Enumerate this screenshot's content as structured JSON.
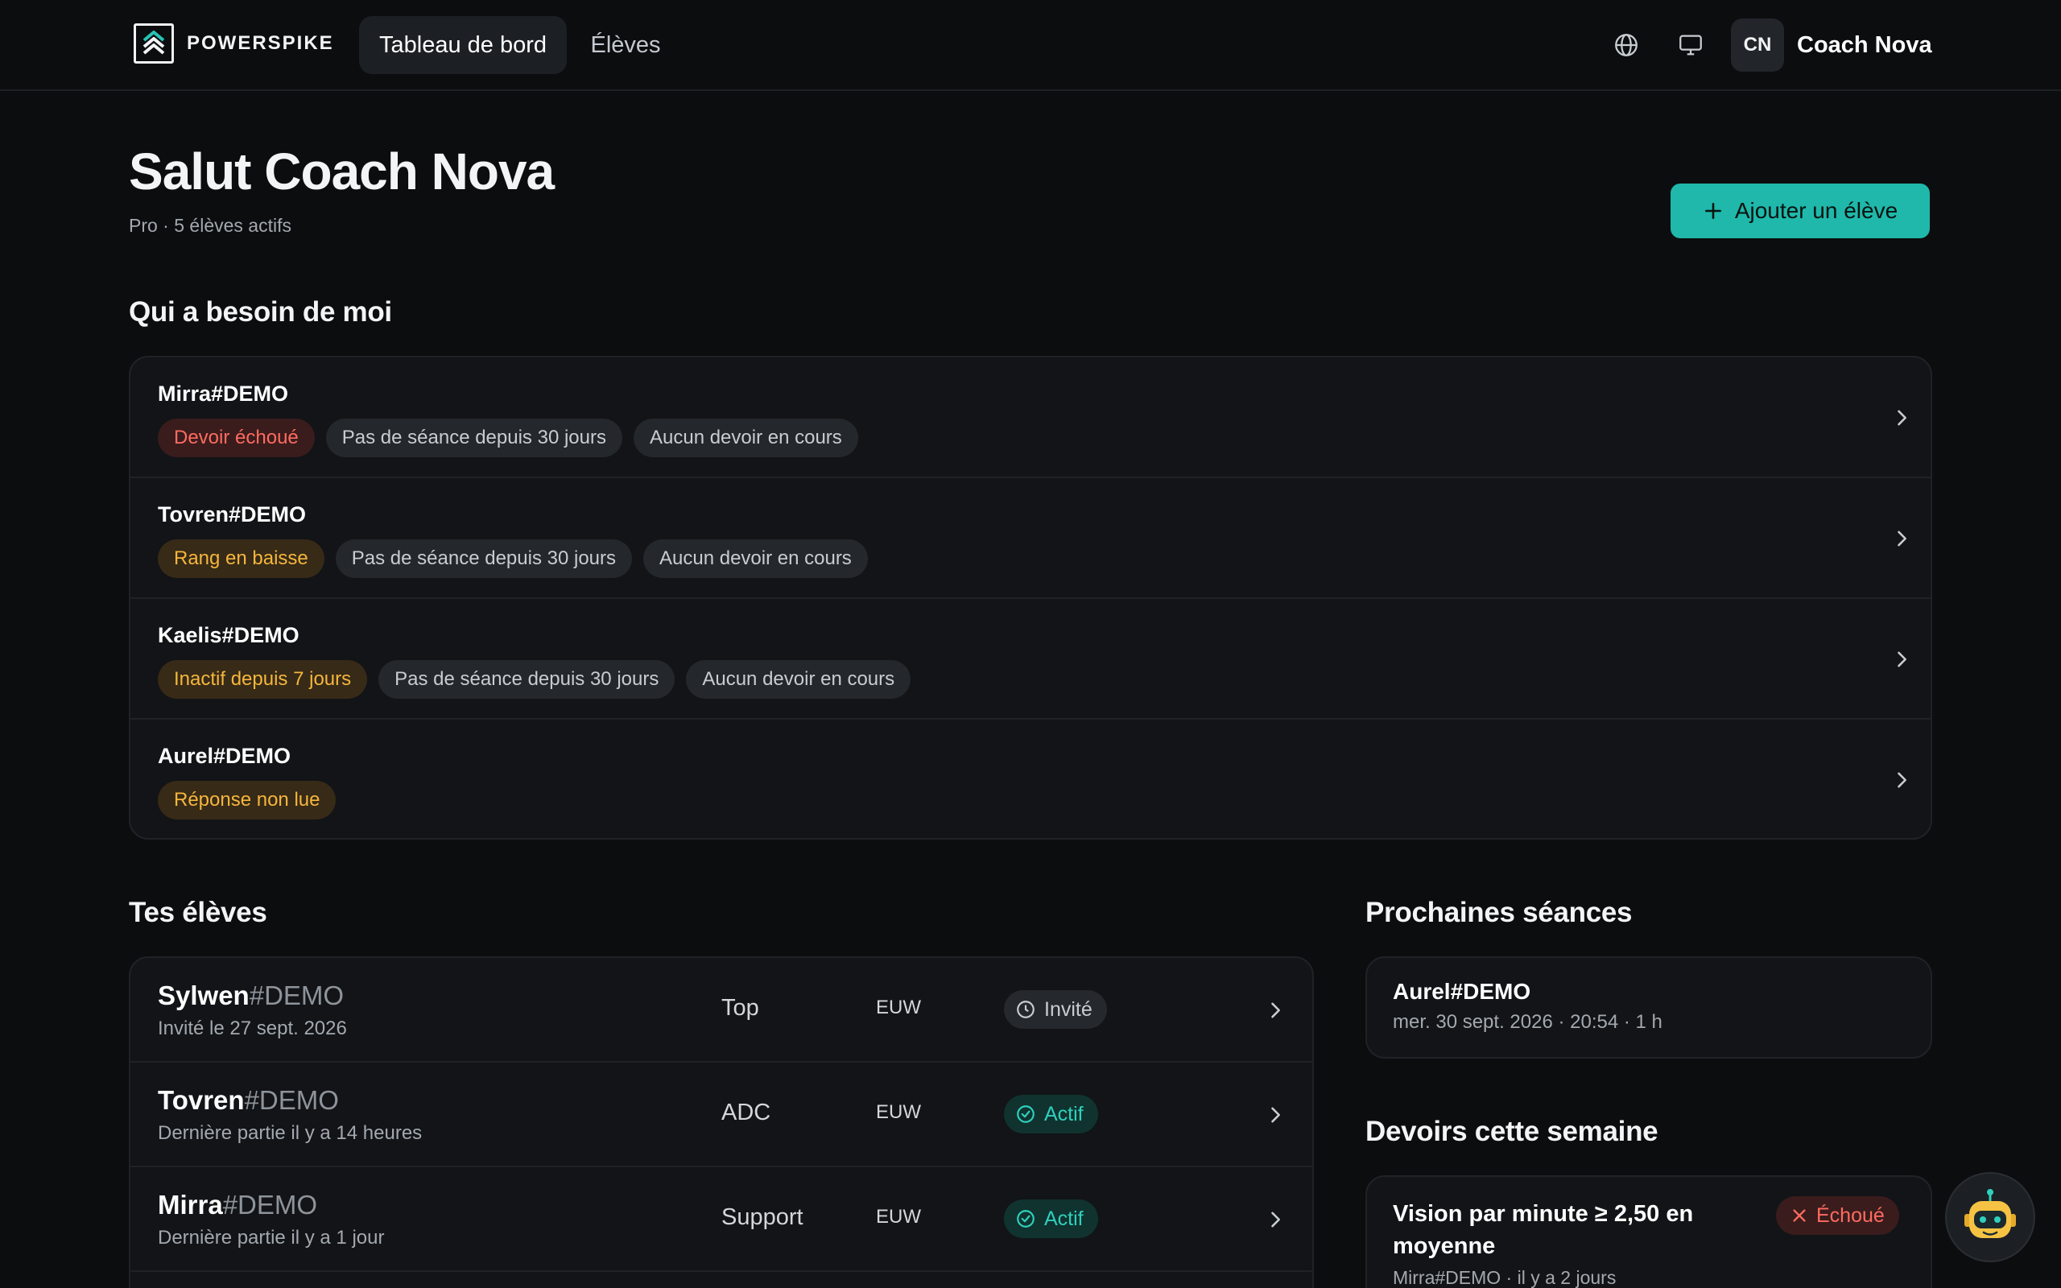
{
  "nav": {
    "brand": "POWERSPIKE",
    "tabs": [
      {
        "label": "Tableau de bord",
        "active": true
      },
      {
        "label": "Élèves",
        "active": false
      }
    ],
    "user": {
      "initials": "CN",
      "name": "Coach Nova"
    },
    "icons": [
      "globe-icon",
      "monitor-icon"
    ]
  },
  "header": {
    "title": "Salut Coach Nova",
    "subtitle": "Pro · 5 élèves actifs",
    "add_button": "Ajouter un élève"
  },
  "needs": {
    "title": "Qui a besoin de moi",
    "rows": [
      {
        "name": "Mirra#DEMO",
        "tags": [
          {
            "label": "Devoir échoué",
            "tone": "red"
          },
          {
            "label": "Pas de séance depuis 30 jours",
            "tone": "gray"
          },
          {
            "label": "Aucun devoir en cours",
            "tone": "gray"
          }
        ]
      },
      {
        "name": "Tovren#DEMO",
        "tags": [
          {
            "label": "Rang en baisse",
            "tone": "amber"
          },
          {
            "label": "Pas de séance depuis 30 jours",
            "tone": "gray"
          },
          {
            "label": "Aucun devoir en cours",
            "tone": "gray"
          }
        ]
      },
      {
        "name": "Kaelis#DEMO",
        "tags": [
          {
            "label": "Inactif depuis 7 jours",
            "tone": "amber"
          },
          {
            "label": "Pas de séance depuis 30 jours",
            "tone": "gray"
          },
          {
            "label": "Aucun devoir en cours",
            "tone": "gray"
          }
        ]
      },
      {
        "name": "Aurel#DEMO",
        "tags": [
          {
            "label": "Réponse non lue",
            "tone": "amber"
          }
        ]
      }
    ]
  },
  "students": {
    "title": "Tes élèves",
    "rows": [
      {
        "name": "Sylwen",
        "tagline": "#DEMO",
        "sub": "Invité le 27 sept. 2026",
        "role": "Top",
        "region": "EUW",
        "status": "Invité",
        "status_type": "invite"
      },
      {
        "name": "Tovren",
        "tagline": "#DEMO",
        "sub": "Dernière partie il y a 14 heures",
        "role": "ADC",
        "region": "EUW",
        "status": "Actif",
        "status_type": "active"
      },
      {
        "name": "Mirra",
        "tagline": "#DEMO",
        "sub": "Dernière partie il y a 1 jour",
        "role": "Support",
        "region": "EUW",
        "status": "Actif",
        "status_type": "active"
      }
    ]
  },
  "sessions": {
    "title": "Prochaines séances",
    "items": [
      {
        "name": "Aurel#DEMO",
        "meta": "mer. 30 sept. 2026 · 20:54 · 1 h"
      }
    ]
  },
  "homework": {
    "title": "Devoirs cette semaine",
    "items": [
      {
        "title": "Vision par minute ≥ 2,50 en moyenne",
        "meta": "Mirra#DEMO · il y a 2 jours",
        "status": "Échoué"
      }
    ]
  },
  "colors": {
    "accent": "#1fb8ab",
    "danger": "#ff6b60",
    "warning": "#f5b63c",
    "background": "#0b0d0f",
    "card": "#121417"
  }
}
